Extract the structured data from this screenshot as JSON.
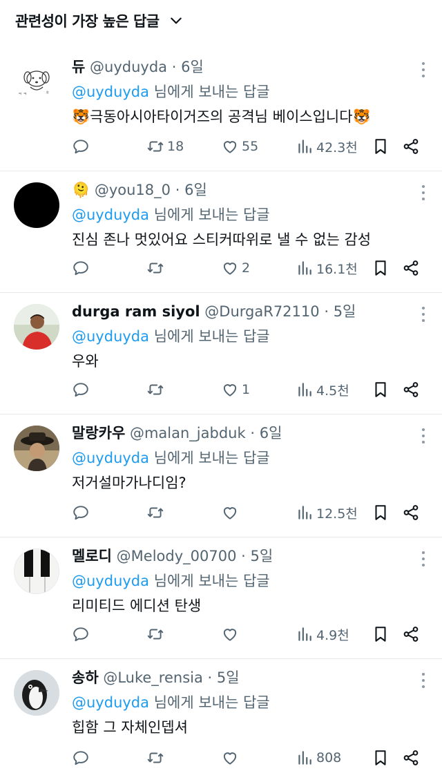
{
  "header": {
    "title": "관련성이 가장 높은 답글",
    "chevron_icon": "chevron-down-icon"
  },
  "replying_prefix": "@uyduyda",
  "replying_suffix": " 님에게 보내는 답글",
  "replies": [
    {
      "name": "듀",
      "handle": "@uyduyda",
      "dot": "·",
      "time": "6일",
      "text": "🐯극동아시아타이거즈의 공격님 베이스입니다🐯",
      "avatar_icon": "puppy-sketch-avatar",
      "retweets": "18",
      "likes": "55",
      "views": "42.3천"
    },
    {
      "name": "🫠",
      "handle": "@you18_0",
      "dot": "·",
      "time": "6일",
      "text": "진심 존나 멋있어요 스티커따위로 낼 수 없는 감성",
      "avatar_icon": "black-circle-avatar",
      "retweets": "",
      "likes": "2",
      "views": "16.1천"
    },
    {
      "name": "durga ram siyol",
      "handle": "@DurgaR72110",
      "dot": "·",
      "time": "5일",
      "text": "우와",
      "avatar_icon": "man-red-shirt-avatar",
      "retweets": "",
      "likes": "1",
      "views": "4.5천"
    },
    {
      "name": "말랑카우",
      "handle": "@malan_jabduk",
      "dot": "·",
      "time": "6일",
      "text": "저거설마가나디임?",
      "avatar_icon": "person-hat-avatar",
      "retweets": "",
      "likes": "",
      "views": "12.5천"
    },
    {
      "name": "멜로디",
      "handle": "@Melody_00700",
      "dot": "·",
      "time": "5일",
      "text": "리미티드 에디션 탄생",
      "avatar_icon": "piano-keys-avatar",
      "retweets": "",
      "likes": "",
      "views": "4.9천"
    },
    {
      "name": "송하",
      "handle": "@Luke_rensia",
      "dot": "·",
      "time": "5일",
      "text": "힙함 그 자체인뎁셔",
      "avatar_icon": "penguin-avatar",
      "retweets": "",
      "likes": "",
      "views": "808"
    }
  ],
  "colors": {
    "link": "#1d9bf0",
    "muted": "#536471",
    "text": "#0f1419",
    "divider": "#e6e9ec"
  }
}
